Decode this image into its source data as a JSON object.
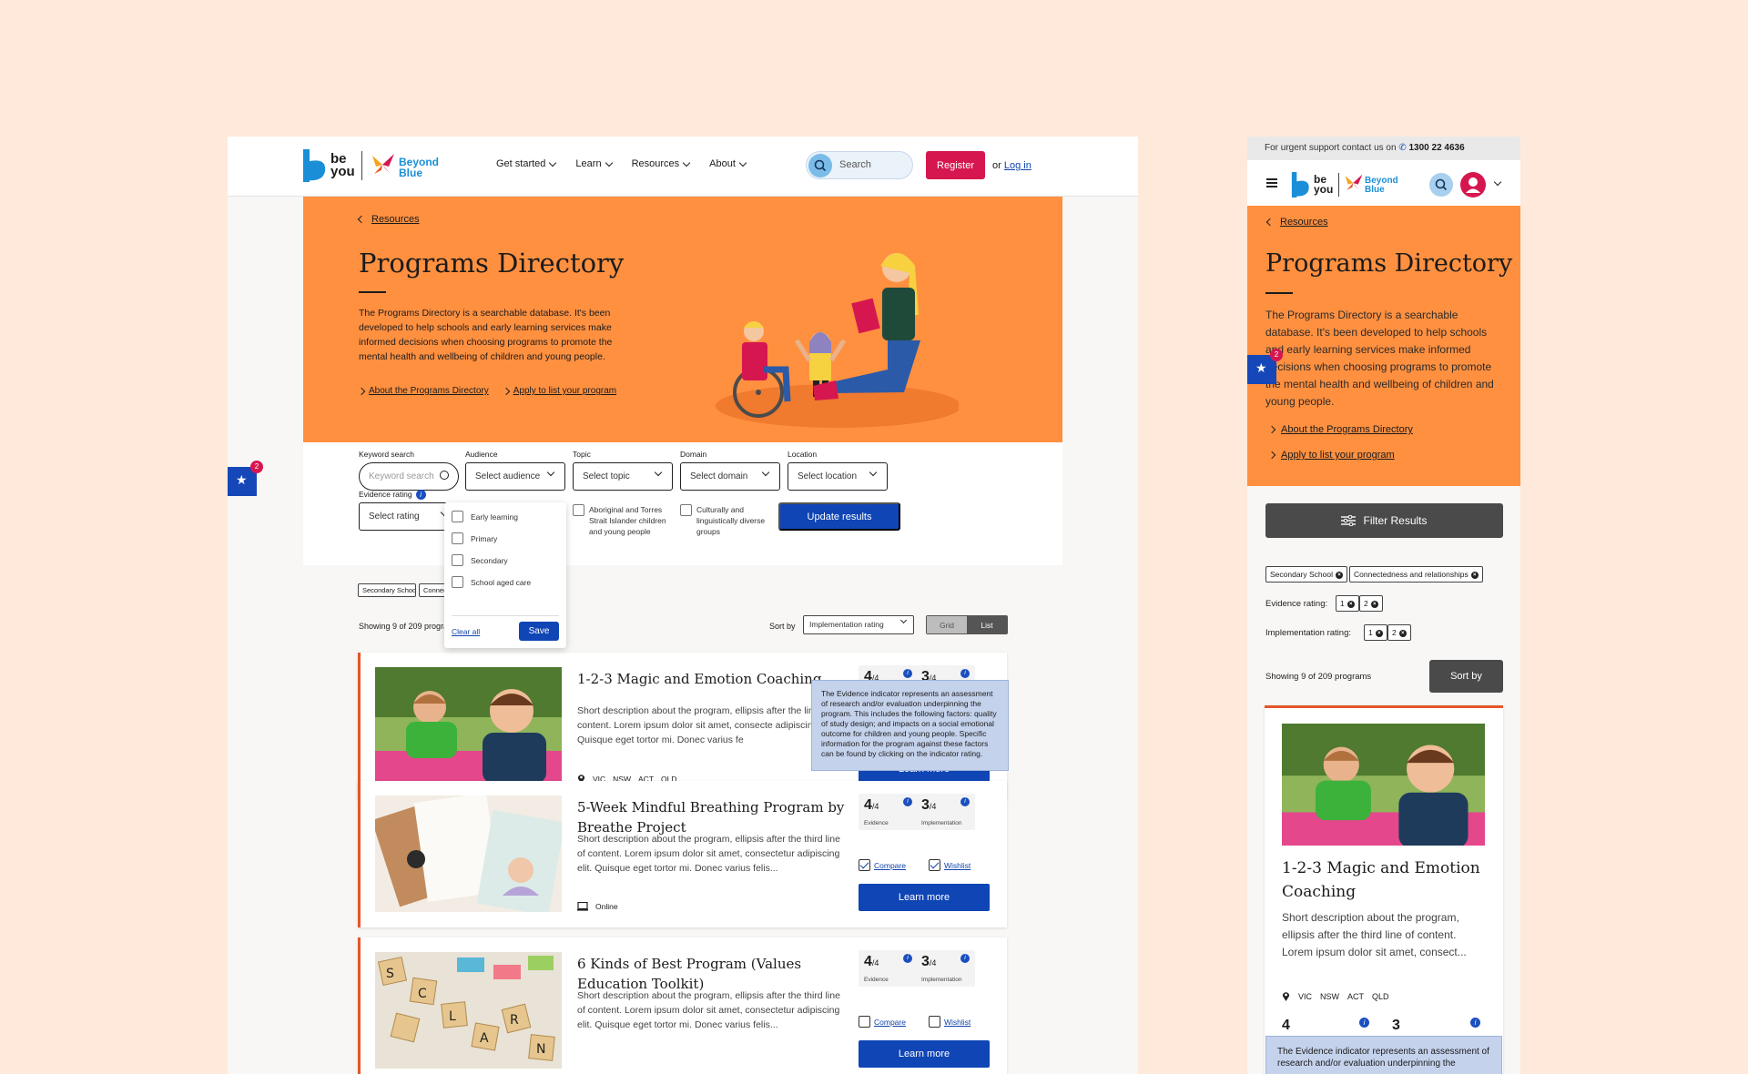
{
  "nav": {
    "logo_beyou": "be you",
    "logo_beyond_blue": "Beyond Blue",
    "links": [
      "Get started",
      "Learn",
      "Resources",
      "About"
    ],
    "search_placeholder": "Search",
    "register": "Register",
    "or": "or",
    "login": "Log in"
  },
  "hero": {
    "breadcrumb": "Resources",
    "title": "Programs Directory",
    "description": "The Programs Directory is a searchable database. It's been developed to help schools and early learning services make informed decisions when choosing programs to promote the mental health and wellbeing of children and young people.",
    "link_about": "About the Programs Directory",
    "link_apply": "Apply to list your program"
  },
  "filters": {
    "keyword_label": "Keyword search",
    "keyword_placeholder": "Keyword search",
    "audience_label": "Audience",
    "audience_value": "Select audience",
    "topic_label": "Topic",
    "topic_value": "Select topic",
    "domain_label": "Domain",
    "domain_value": "Select domain",
    "location_label": "Location",
    "location_value": "Select location",
    "evidence_label": "Evidence rating",
    "evidence_value": "Select rating",
    "check_atsi": "Aboriginal and Torres Strait Islander children and young people",
    "check_cald": "Culturally and linguistically diverse groups",
    "update": "Update results"
  },
  "audience_dropdown": {
    "options": [
      "Early learning",
      "Primary",
      "Secondary",
      "School aged care"
    ],
    "clear": "Clear all",
    "save": "Save"
  },
  "active_chips": [
    "Secondary School",
    "Connectedness and relationships"
  ],
  "active_chips_desktop_visible": [
    "Secondary School",
    "Connectedness ar"
  ],
  "results": {
    "showing": "Showing 9 of 209 programs",
    "sort_label": "Sort by",
    "sort_value": "Implementation rating",
    "view_grid": "Grid",
    "view_list": "List"
  },
  "programs": [
    {
      "title": "1-2-3 Magic and Emotion Coaching",
      "description": "Short description about the program, ellipsis after the third line of content. Lorem ipsum dolor sit amet, consectetur adipiscing elit. Quisque eget tortor mi. Donec varius felis...",
      "desc_desktop_visible": "Short description about the program, ellipsis after the line of content. Lorem ipsum dolor sit amet, consecte adipiscing elit. Quisque eget tortor mi. Donec varius fe",
      "locations": [
        "VIC",
        "NSW",
        "ACT",
        "QLD"
      ],
      "evidence": "4",
      "implementation": "3"
    },
    {
      "title": "5-Week Mindful Breathing Program by Breathe Project",
      "description": "Short description about the program, ellipsis after the third line of content. Lorem ipsum dolor sit amet, consectetur adipiscing elit. Quisque eget tortor mi. Donec varius felis...",
      "delivery": "Online",
      "evidence": "4",
      "implementation": "3"
    },
    {
      "title": "6 Kinds of Best Program (Values Education Toolkit)",
      "description": "Short description about the program, ellipsis after the third line of content. Lorem ipsum dolor sit amet, consectetur adipiscing elit. Quisque eget tortor mi. Donec varius felis...",
      "evidence": "4",
      "implementation": "3"
    }
  ],
  "rating": {
    "out_of": "/4",
    "evidence_label": "Evidence",
    "implementation_label": "Implementation"
  },
  "card_actions": {
    "compare": "Compare",
    "wishlist": "Wishlist",
    "learn_more": "Learn more"
  },
  "tooltip": "The Evidence indicator represents an assessment of research and/or evaluation underpinning the program. This includes the following factors: quality of study design; and impacts on a social emotional outcome for children and young people.  Specific information for the program against these factors can be found by clicking on the indicator rating.",
  "favourites_count": "2",
  "mobile": {
    "support_text": "For urgent support contact us on",
    "support_phone": "1300 22 4636",
    "filter_button": "Filter Results",
    "evidence_rating_label": "Evidence rating:",
    "implementation_rating_label": "Implementation rating:",
    "rating_chips": [
      "1",
      "2"
    ],
    "sort_button": "Sort by",
    "card_description": "Short description about the program, ellipsis after the third line of content. Lorem ipsum dolor sit amet, consect...",
    "tooltip": "The Evidence indicator represents an assessment of research and/or evaluation underpinning the"
  },
  "colors": {
    "hero": "#ff9040",
    "primary": "#0f45b5",
    "accent": "#d6174f",
    "card_border": "#e3572a"
  }
}
